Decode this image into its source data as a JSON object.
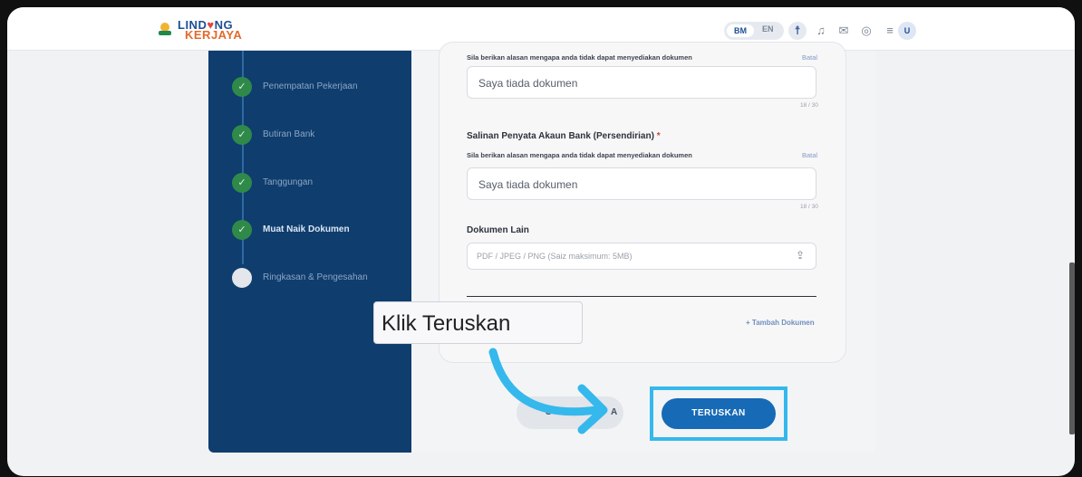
{
  "header": {
    "logo_line1": "LIND",
    "logo_heart": "♥",
    "logo_line1_end": "NG",
    "logo_line2": "KERJAYA",
    "lang_bm": "BM",
    "lang_en": "EN",
    "avatar_initial": "U",
    "icons": [
      "accessibility-icon",
      "bell-icon",
      "mail-icon",
      "palette-icon",
      "menu-icon"
    ]
  },
  "sidebar": {
    "steps": [
      {
        "label": "Penempatan Pekerjaan",
        "status": "done"
      },
      {
        "label": "Butiran Bank",
        "status": "done"
      },
      {
        "label": "Tanggungan",
        "status": "done"
      },
      {
        "label": "Muat Naik Dokumen",
        "status": "active"
      },
      {
        "label": "Ringkasan & Pengesahan",
        "status": "pending"
      }
    ]
  },
  "form": {
    "reason_hint": "Sila berikan alasan mengapa anda tidak dapat menyediakan dokumen",
    "batal": "Batal",
    "reason1_value": "Saya tiada dokumen",
    "reason1_count": "18 / 30",
    "section2_title": "Salinan Penyata Akaun Bank (Persendirian)",
    "required_mark": "*",
    "reason2_value": "Saya tiada dokumen",
    "reason2_count": "18 / 30",
    "other_docs_title": "Dokumen Lain",
    "upload_placeholder": "PDF / JPEG / PNG (Saiz maksimum: 5MB)",
    "faded_label": "AN",
    "add_document": "+ Tambah Dokumen"
  },
  "footer": {
    "back_label_left": "S",
    "back_label_right": "A",
    "next_label": "TERUSKAN"
  },
  "tutorial": {
    "tooltip_text": "Klik Teruskan",
    "highlight_color": "#35b8ec"
  },
  "colors": {
    "primary": "#176ab6",
    "sidebar_bg": "#0f3d6e",
    "step_done": "#2f8a4a"
  }
}
